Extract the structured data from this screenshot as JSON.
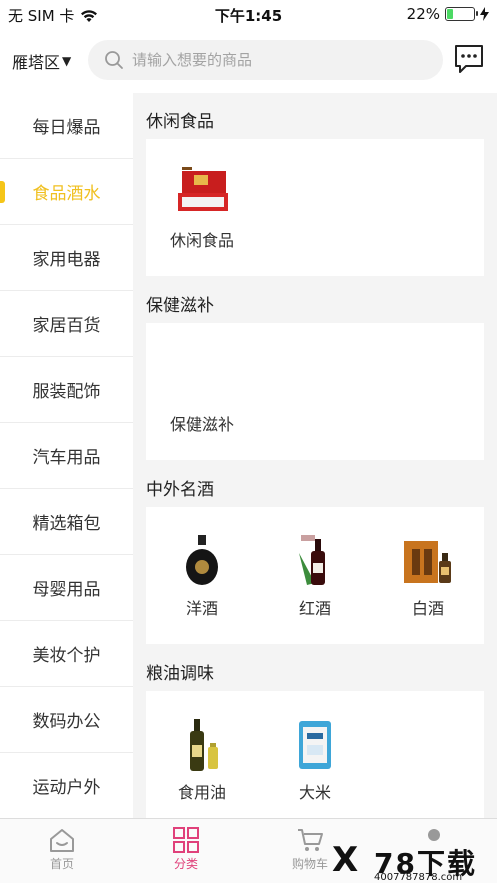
{
  "status_bar": {
    "carrier": "无 SIM 卡",
    "time": "下午1:45",
    "battery": "22%",
    "battery_level": 0.22
  },
  "header": {
    "city": "雁塔区",
    "city_arrow": "▼",
    "search_placeholder": "请输入想要的商品"
  },
  "sidebar": {
    "items": [
      {
        "label": "每日爆品"
      },
      {
        "label": "食品酒水",
        "active": true
      },
      {
        "label": "家用电器"
      },
      {
        "label": "家居百货"
      },
      {
        "label": "服装配饰"
      },
      {
        "label": "汽车用品"
      },
      {
        "label": "精选箱包"
      },
      {
        "label": "母婴用品"
      },
      {
        "label": "美妆个护"
      },
      {
        "label": "数码办公"
      },
      {
        "label": "运动户外"
      }
    ],
    "active_color": "#f0c020"
  },
  "sections": [
    {
      "title": "休闲食品",
      "products": [
        {
          "label": "休闲食品",
          "icon": "snack-gift-box-image"
        }
      ]
    },
    {
      "title": "保健滋补",
      "products": [
        {
          "label": "保健滋补",
          "icon": ""
        }
      ]
    },
    {
      "title": "中外名酒",
      "products": [
        {
          "label": "洋酒",
          "icon": "liquor-bottle-image"
        },
        {
          "label": "红酒",
          "icon": "red-wine-image"
        },
        {
          "label": "白酒",
          "icon": "baijiu-box-image"
        }
      ]
    },
    {
      "title": "粮油调味",
      "products": [
        {
          "label": "食用油",
          "icon": "cooking-oil-image"
        },
        {
          "label": "大米",
          "icon": "rice-bag-image"
        }
      ]
    }
  ],
  "tabbar": {
    "tabs": [
      {
        "label": "首页",
        "icon": "home-icon"
      },
      {
        "label": "分类",
        "icon": "category-grid-icon",
        "active": true
      },
      {
        "label": "购物车",
        "icon": "cart-icon"
      },
      {
        "label": "",
        "icon": "user-icon"
      }
    ],
    "active_color": "#e0407a"
  },
  "watermark": {
    "mark": "X",
    "brand": "78下载",
    "url": "4007787878.com"
  }
}
